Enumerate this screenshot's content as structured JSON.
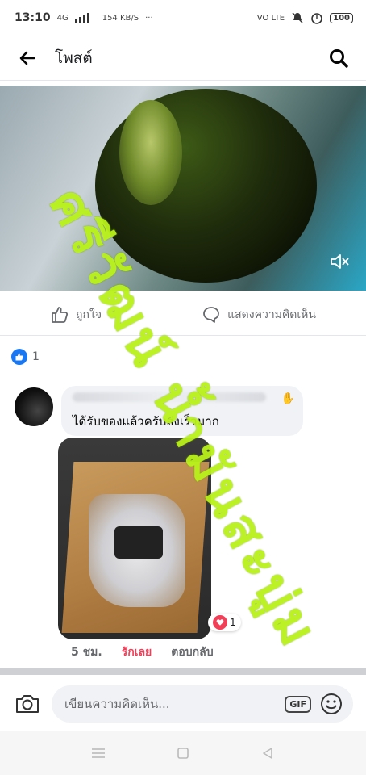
{
  "statusbar": {
    "time": "13:10",
    "network": "4G",
    "speed": "154 KB/S",
    "more": "···",
    "volte": "VO LTE",
    "battery": "100"
  },
  "navbar": {
    "title": "โพสต์"
  },
  "post": {
    "actions": {
      "like_label": "ถูกใจ",
      "comment_label": "แสดงความคิดเห็น"
    },
    "reaction_count": "1"
  },
  "comment": {
    "text": "ได้รับของแล้วครับส่งเร็วมาก",
    "love_count": "1",
    "time": "5 ชม.",
    "loved_label": "รักเลย",
    "reply_label": "ตอบกลับ"
  },
  "composer": {
    "placeholder": "เขียนความคิดเห็น...",
    "gif_label": "GIF"
  },
  "watermark": {
    "text": "ศรีวัฒน์ น้ำมันสะบู่ม"
  },
  "colors": {
    "facebook_blue": "#1877f2",
    "love_red": "#f33e58",
    "watermark_green": "#b9f21a"
  }
}
